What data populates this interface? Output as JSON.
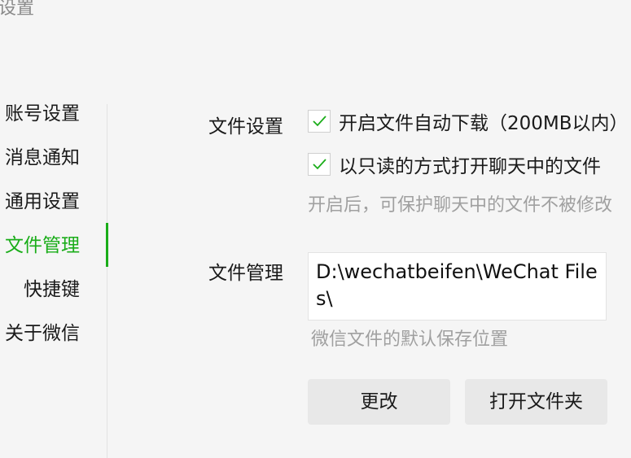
{
  "window": {
    "title": "设置"
  },
  "sidebar": {
    "items": [
      {
        "label": "账号设置"
      },
      {
        "label": "消息通知"
      },
      {
        "label": "通用设置"
      },
      {
        "label": "文件管理",
        "active": true
      },
      {
        "label": "快捷键"
      },
      {
        "label": "关于微信"
      }
    ]
  },
  "file_settings": {
    "label": "文件设置",
    "options": [
      {
        "label": "开启文件自动下载（200MB以内）",
        "checked": true
      },
      {
        "label": "以只读的方式打开聊天中的文件",
        "checked": true
      }
    ],
    "hint": "开启后，可保护聊天中的文件不被修改"
  },
  "file_management": {
    "label": "文件管理",
    "path": "D:\\wechatbeifen\\WeChat Files\\",
    "hint": "微信文件的默认保存位置",
    "change_button": "更改",
    "open_folder_button": "打开文件夹"
  },
  "colors": {
    "accent": "#1aad19",
    "background": "#f5f5f5",
    "button": "#e8e8e8",
    "hint_text": "#a0a0a0"
  }
}
